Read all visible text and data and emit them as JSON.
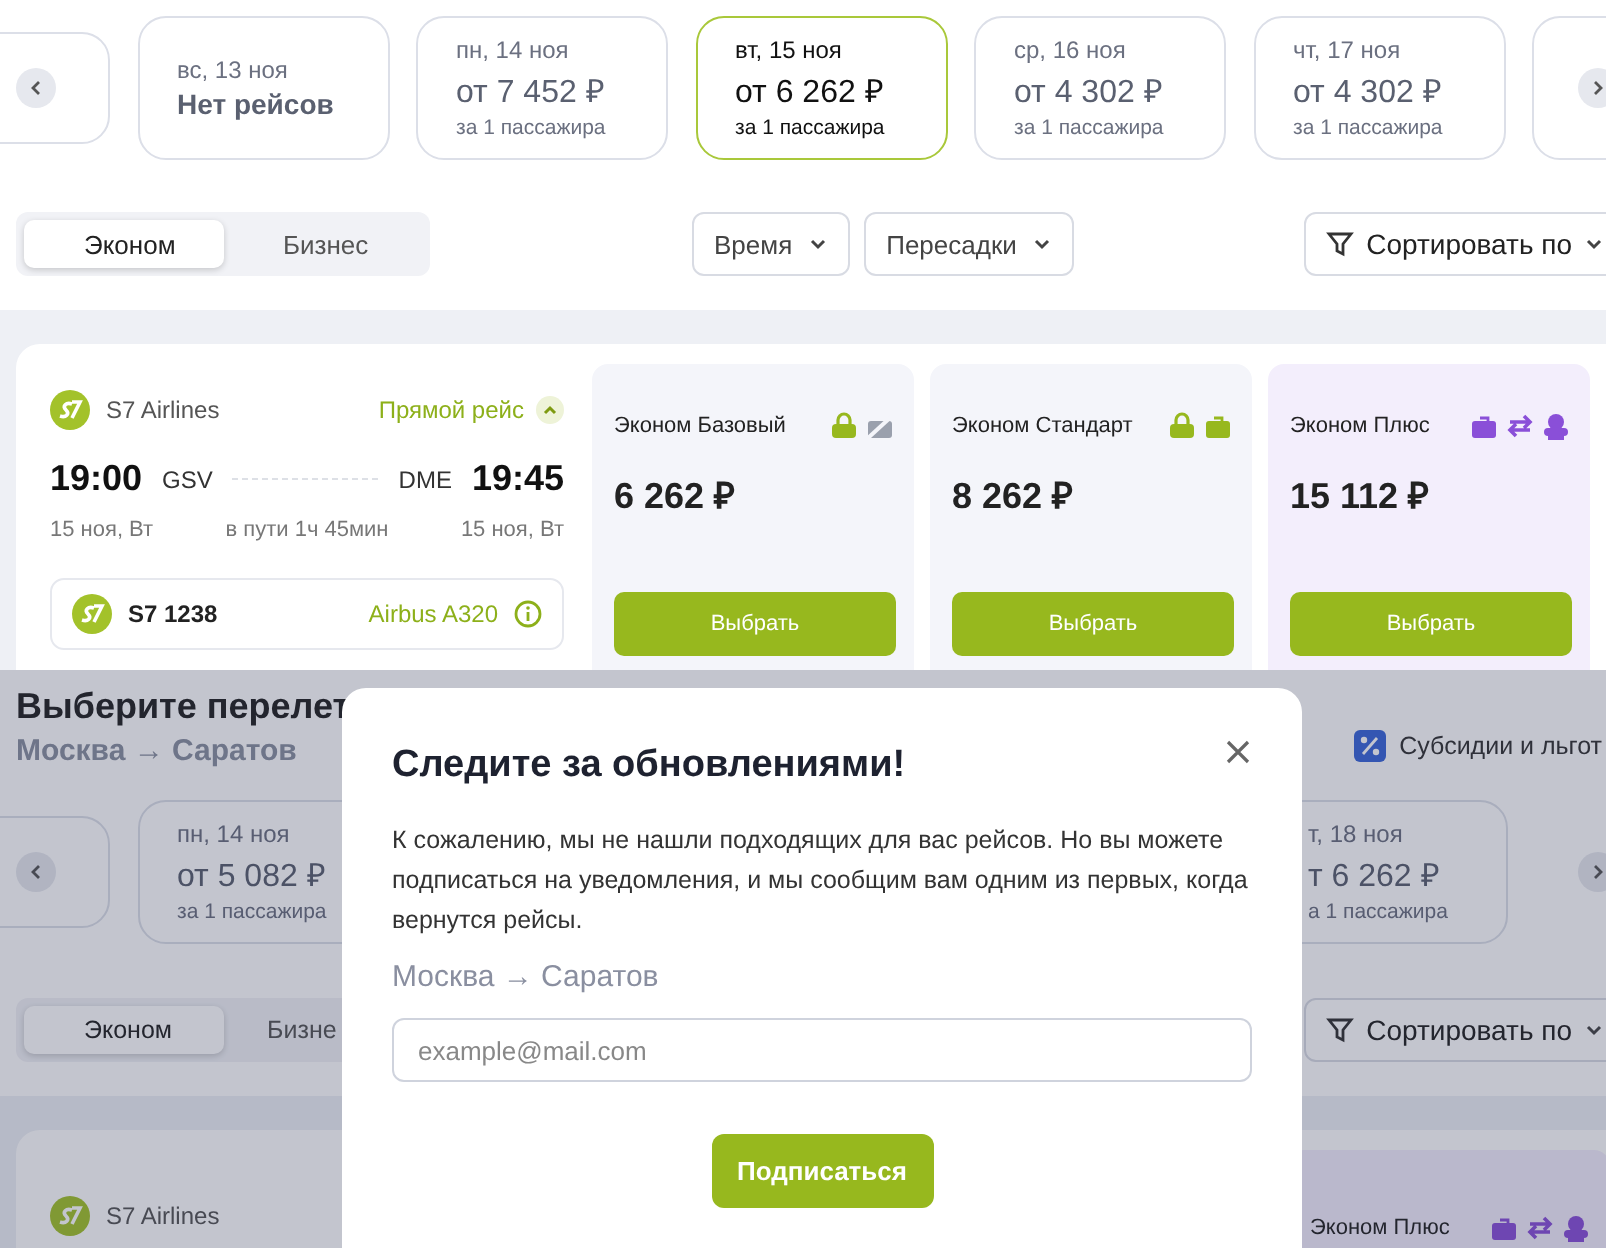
{
  "top_view": {
    "dates": [
      {
        "kind": "empty",
        "day": "вс, 13 ноя",
        "price": "Нет рейсов",
        "selected": false
      },
      {
        "kind": "priced",
        "day": "пн, 14 ноя",
        "price": "от 7 452 ₽",
        "note": "за 1 пассажира",
        "selected": false
      },
      {
        "kind": "priced",
        "day": "вт, 15 ноя",
        "price": "от 6 262 ₽",
        "note": "за 1 пассажира",
        "selected": true
      },
      {
        "kind": "priced",
        "day": "ср, 16 ноя",
        "price": "от 4 302 ₽",
        "note": "за 1 пассажира",
        "selected": false
      },
      {
        "kind": "priced",
        "day": "чт, 17 ноя",
        "price": "от 4 302 ₽",
        "note": "за 1 пассажира",
        "selected": false
      }
    ],
    "class_tabs": [
      {
        "label": "Эконом",
        "selected": true
      },
      {
        "label": "Бизнес",
        "selected": false
      }
    ],
    "filters": [
      "Время",
      "Пересадки"
    ],
    "sort": "Сортировать по",
    "flight": {
      "airline": "S7 Airlines",
      "direct": "Прямой рейс",
      "expanded": true,
      "dep_time": "19:00",
      "dep_code": "GSV",
      "arr_code": "DME",
      "arr_time": "19:45",
      "dep_date": "15 ноя, Вт",
      "duration": "в пути 1ч 45мин",
      "arr_date": "15 ноя, Вт",
      "flight_number": "S7 1238",
      "aircraft": "Airbus A320",
      "fares": [
        {
          "kind": "basic",
          "name": "Эконом Базовый",
          "price": "6 262 ₽",
          "button": "Выбрать"
        },
        {
          "kind": "standard",
          "name": "Эконом Стандарт",
          "price": "8 262 ₽",
          "button": "Выбрать"
        },
        {
          "kind": "plus",
          "name": "Эконом Плюс",
          "price": "15 112 ₽",
          "button": "Выбрать"
        }
      ]
    }
  },
  "bottom_view": {
    "heading": "Выберите перелет",
    "route": "Москва → Саратов",
    "subsidies": "Субсидии и льгот",
    "dates": [
      {
        "kind": "priced",
        "day": "пн, 14 ноя",
        "price": "от 5 082 ₽",
        "note": "за 1 пассажира",
        "selected": false
      },
      {
        "kind": "priced",
        "day": "т, 18 ноя",
        "price": "т 6 262 ₽",
        "note": "а 1 пассажира",
        "selected": false
      }
    ],
    "class_tabs": [
      {
        "label": "Эконом",
        "selected": true
      },
      {
        "label": "Бизне",
        "selected": false
      }
    ],
    "sort": "Сортировать по",
    "flight": {
      "airline": "S7 Airlines",
      "fares": [
        {
          "kind": "plus",
          "name": "Эконом Плюс"
        }
      ]
    },
    "modal": {
      "title": "Следите за обновлениями!",
      "text": "К сожалению, мы не нашли подходящих для вас рейсов. Но вы можете подписаться на уведомления, и мы сообщим вам одним из первых, когда вернутся рейсы.",
      "route": "Москва → Саратов",
      "email_placeholder": "example@mail.com",
      "button": "Подписаться"
    }
  }
}
